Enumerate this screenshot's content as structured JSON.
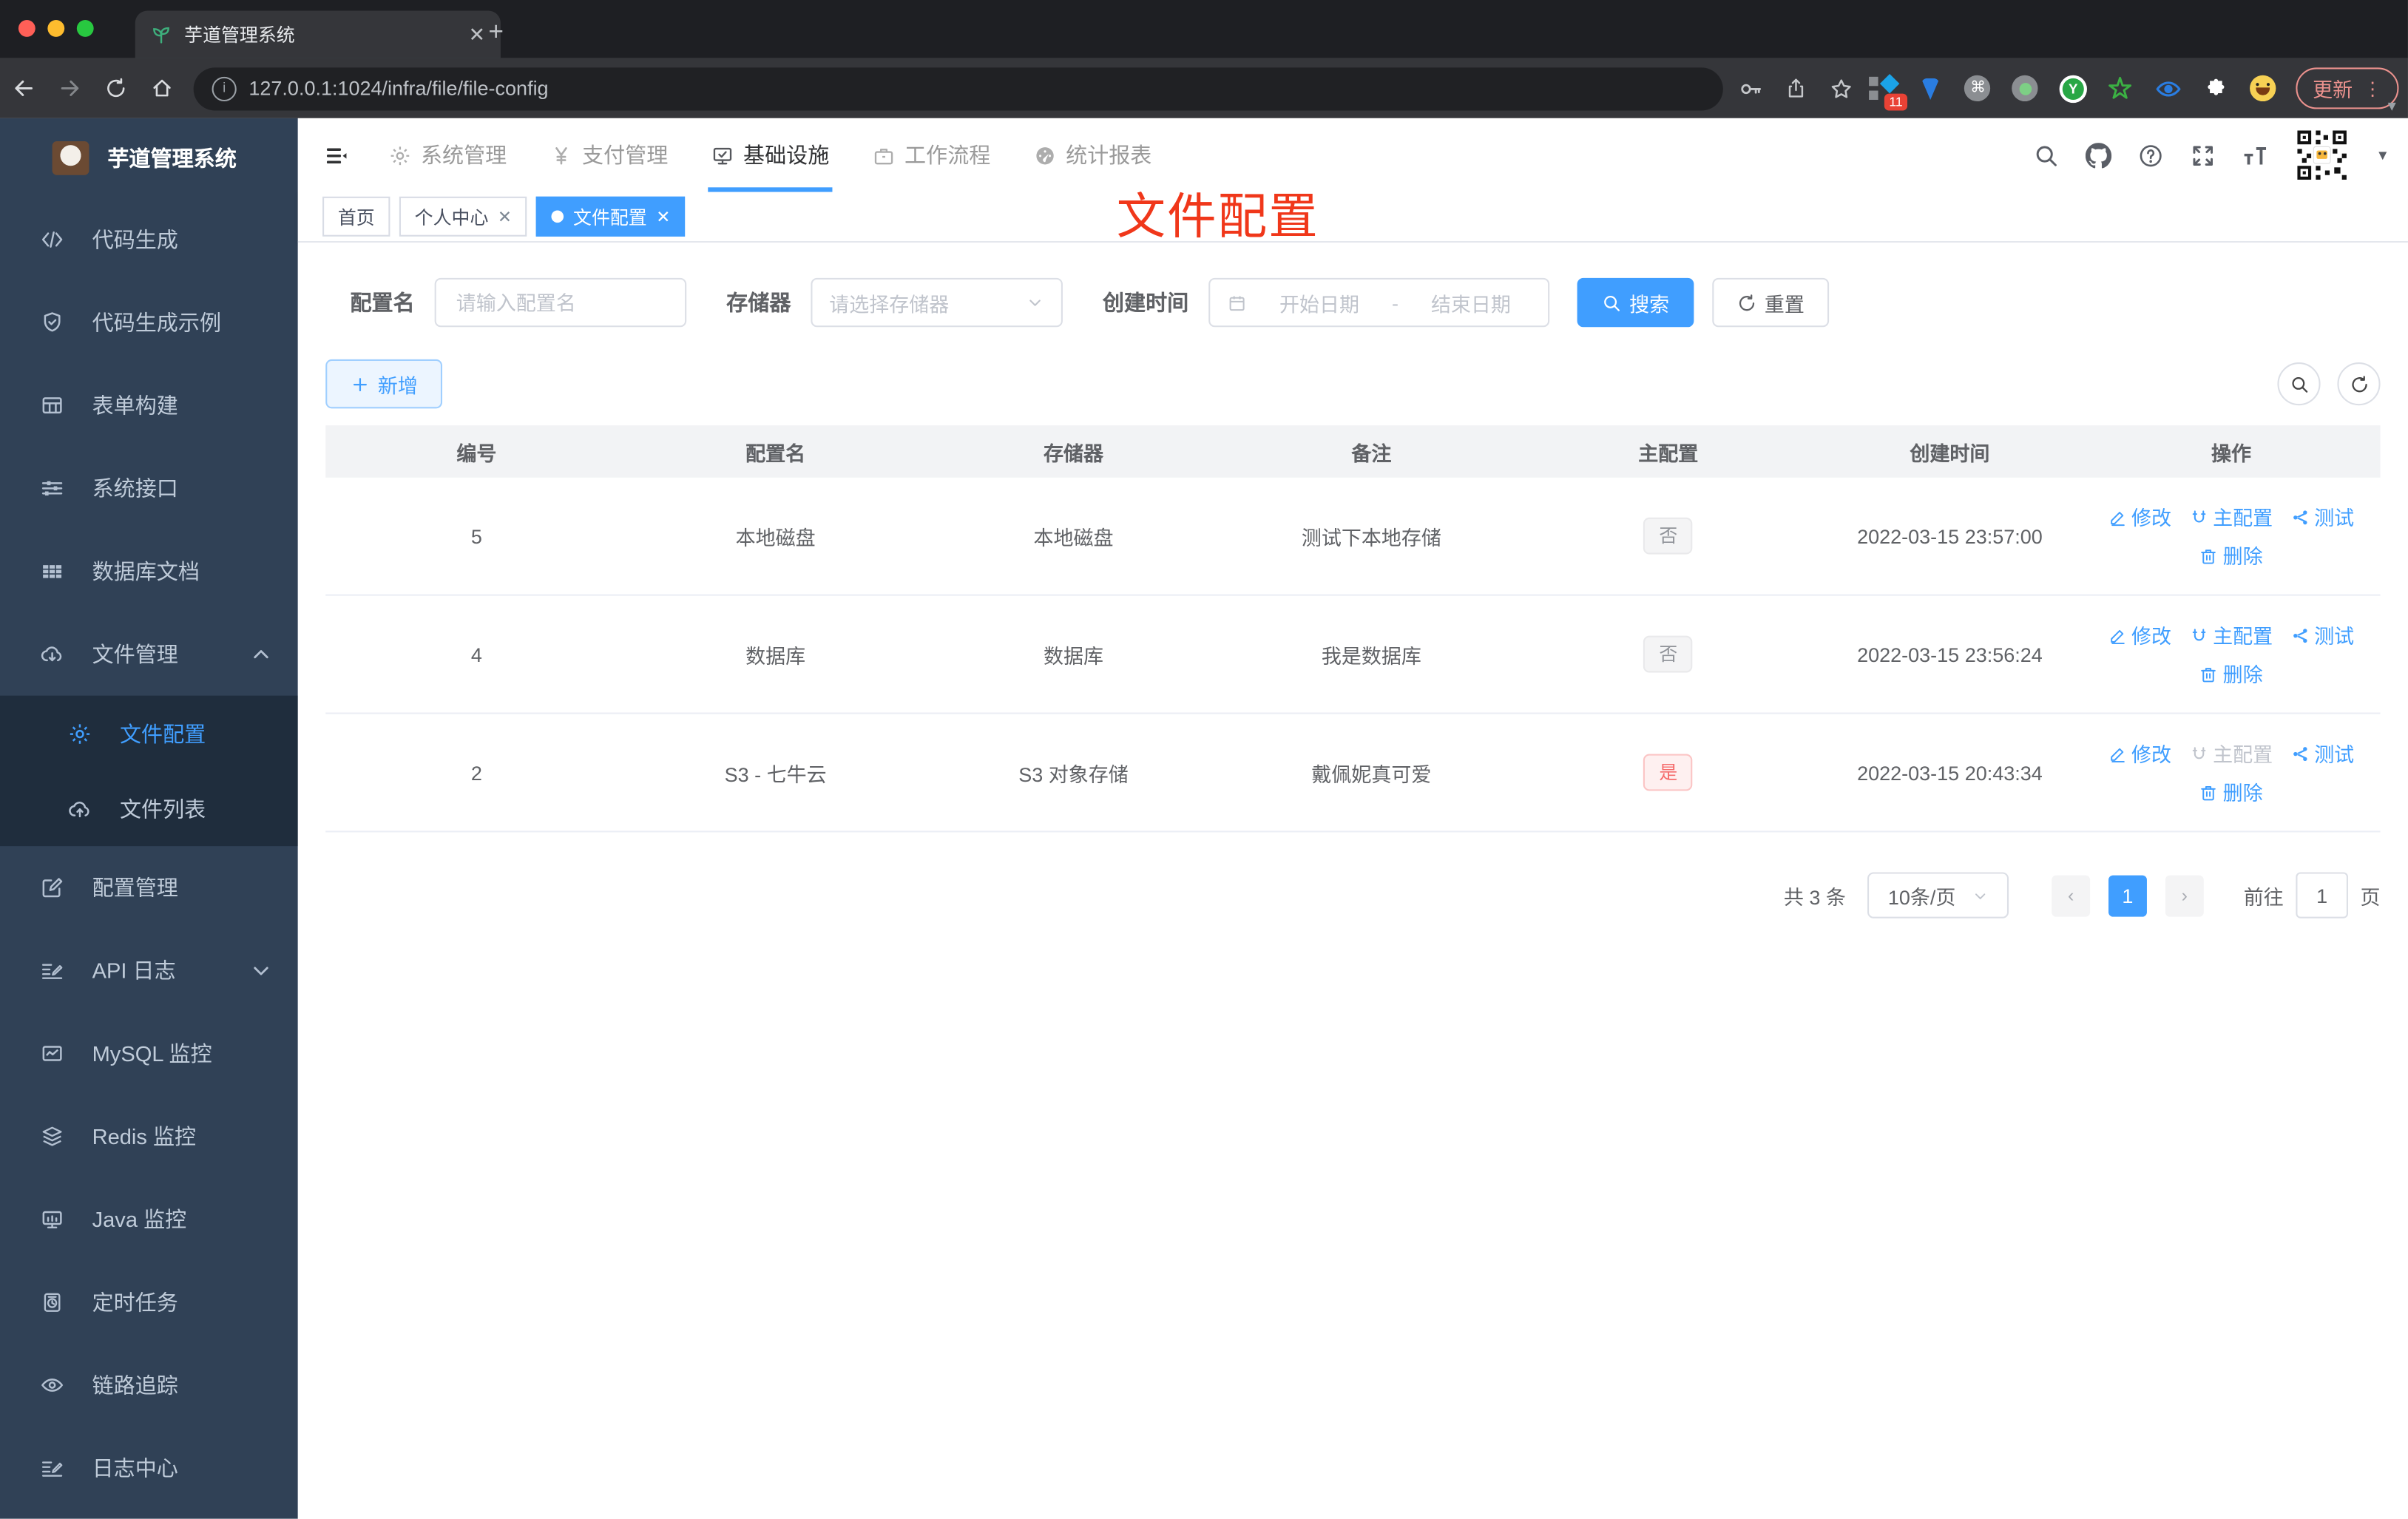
{
  "browser": {
    "tab_title": "芋道管理系统",
    "url": "127.0.0.1:1024/infra/file/file-config",
    "update_label": "更新",
    "extension_badge": "11",
    "extension_y": "Y",
    "extension_cmd": "⌘"
  },
  "sidebar": {
    "title": "芋道管理系统",
    "items": [
      {
        "label": "代码生成"
      },
      {
        "label": "代码生成示例"
      },
      {
        "label": "表单构建"
      },
      {
        "label": "系统接口"
      },
      {
        "label": "数据库文档"
      },
      {
        "label": "文件管理"
      },
      {
        "label": "文件配置"
      },
      {
        "label": "文件列表"
      },
      {
        "label": "配置管理"
      },
      {
        "label": "API 日志"
      },
      {
        "label": "MySQL 监控"
      },
      {
        "label": "Redis 监控"
      },
      {
        "label": "Java 监控"
      },
      {
        "label": "定时任务"
      },
      {
        "label": "链路追踪"
      },
      {
        "label": "日志中心"
      }
    ]
  },
  "topnav": {
    "items": [
      {
        "label": "系统管理"
      },
      {
        "label": "支付管理"
      },
      {
        "label": "基础设施"
      },
      {
        "label": "工作流程"
      },
      {
        "label": "统计报表"
      }
    ]
  },
  "tags": [
    {
      "label": "首页"
    },
    {
      "label": "个人中心"
    },
    {
      "label": "文件配置"
    }
  ],
  "annotation": "文件配置",
  "filter": {
    "name_label": "配置名",
    "name_placeholder": "请输入配置名",
    "storage_label": "存储器",
    "storage_placeholder": "请选择存储器",
    "date_label": "创建时间",
    "date_start_placeholder": "开始日期",
    "date_separator": "-",
    "date_end_placeholder": "结束日期",
    "search_label": "搜索",
    "reset_label": "重置"
  },
  "toolbar": {
    "add_label": "新增"
  },
  "table": {
    "headers": [
      "编号",
      "配置名",
      "存储器",
      "备注",
      "主配置",
      "创建时间",
      "操作"
    ],
    "action_labels": {
      "edit": "修改",
      "master": "主配置",
      "test": "测试",
      "delete": "删除"
    },
    "rows": [
      {
        "id": "5",
        "name": "本地磁盘",
        "storage": "本地磁盘",
        "remark": "测试下本地存储",
        "master": "否",
        "created": "2022-03-15 23:57:00"
      },
      {
        "id": "4",
        "name": "数据库",
        "storage": "数据库",
        "remark": "我是数据库",
        "master": "否",
        "created": "2022-03-15 23:56:24"
      },
      {
        "id": "2",
        "name": "S3 - 七牛云",
        "storage": "S3 对象存储",
        "remark": "戴佩妮真可爱",
        "master": "是",
        "created": "2022-03-15 20:43:34"
      }
    ]
  },
  "pagination": {
    "total": "共 3 条",
    "page_size": "10条/页",
    "current_page": "1",
    "goto_label": "前往",
    "goto_value": "1",
    "page_unit": "页"
  },
  "colors": {
    "accent": "#409eff",
    "danger": "#f56c6c",
    "sidebar_bg": "#304156",
    "submenu_bg": "#1f2d3d",
    "annotation_red": "#f0371a"
  }
}
